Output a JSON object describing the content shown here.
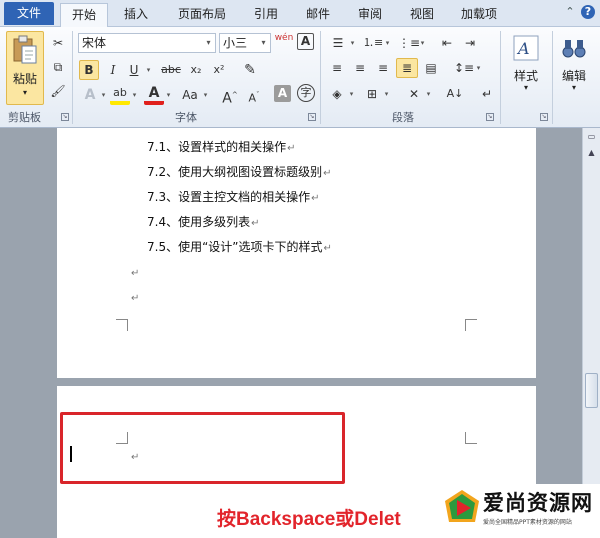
{
  "tabs": {
    "file": "文件",
    "home": "开始",
    "insert": "插入",
    "page_layout": "页面布局",
    "references": "引用",
    "mailings": "邮件",
    "review": "审阅",
    "view": "视图",
    "addins": "加载项"
  },
  "ribbon": {
    "clipboard": {
      "paste_label": "粘贴",
      "group_label": "剪贴板"
    },
    "font": {
      "font_name": "宋体",
      "font_size": "小三",
      "group_label": "字体",
      "bold": "B",
      "italic": "I",
      "underline": "U",
      "strike": "abc",
      "subscript": "x₂",
      "superscript": "x²",
      "grow": "A",
      "shrink": "A",
      "case": "Aa",
      "char_shading": "A",
      "enclose": "字",
      "phonetic": "wén",
      "border_char": "A"
    },
    "paragraph": {
      "group_label": "段落"
    },
    "styles": {
      "label": "样式"
    },
    "editing": {
      "label": "编辑"
    }
  },
  "document": {
    "page1_lines": [
      "7.1、设置样式的相关操作",
      "7.2、使用大纲视图设置标题级别",
      "7.3、设置主控文档的相关操作",
      "7.4、使用多级列表",
      "7.5、使用“设计”选项卡下的样式"
    ],
    "para_mark": "↵",
    "instruction": "按Backspace或Delet"
  },
  "watermark": {
    "title": "爱尚资源网",
    "subtitle": "爱尚全国精品PPT素材资源的网站"
  },
  "colors": {
    "file_tab": "#2f64b5",
    "highlight": "#d9252a",
    "instruction_text": "#e2242b",
    "active_button": "#fbe6a1"
  }
}
